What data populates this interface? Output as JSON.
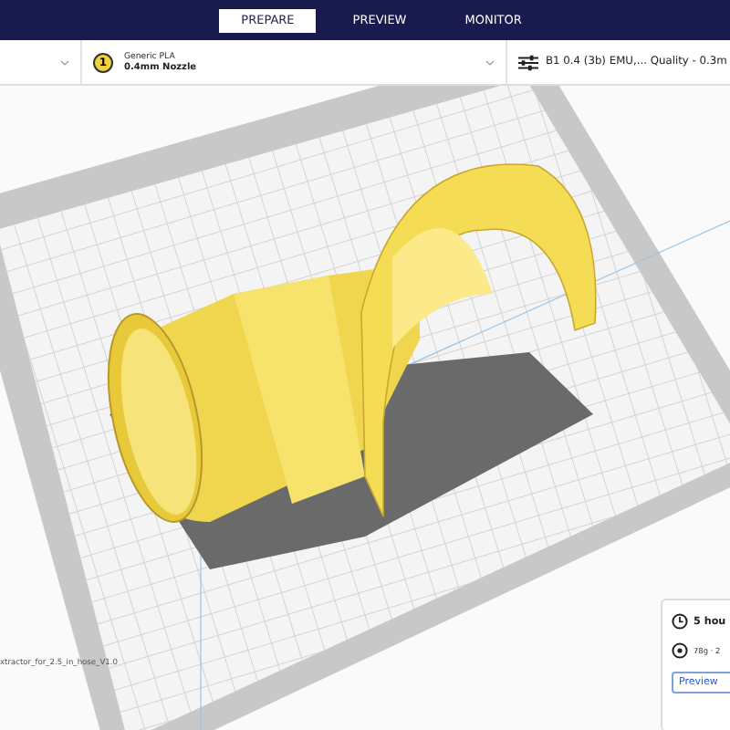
{
  "header": {
    "tabs": [
      {
        "label": "PREPARE",
        "selected": true
      },
      {
        "label": "PREVIEW",
        "selected": false
      },
      {
        "label": "MONITOR",
        "selected": false
      }
    ]
  },
  "toolbar": {
    "extruder": {
      "number": "1",
      "material": "Generic PLA",
      "nozzle": "0.4mm Nozzle"
    },
    "profile": "B1 0.4 (3b) EMU,... Quality - 0.3m"
  },
  "viewport": {
    "object_name": "xtractor_for_2.5_in_hose_V1.0"
  },
  "print_summary": {
    "time": "5 hou",
    "material": "78g · 2",
    "button": "Preview"
  }
}
